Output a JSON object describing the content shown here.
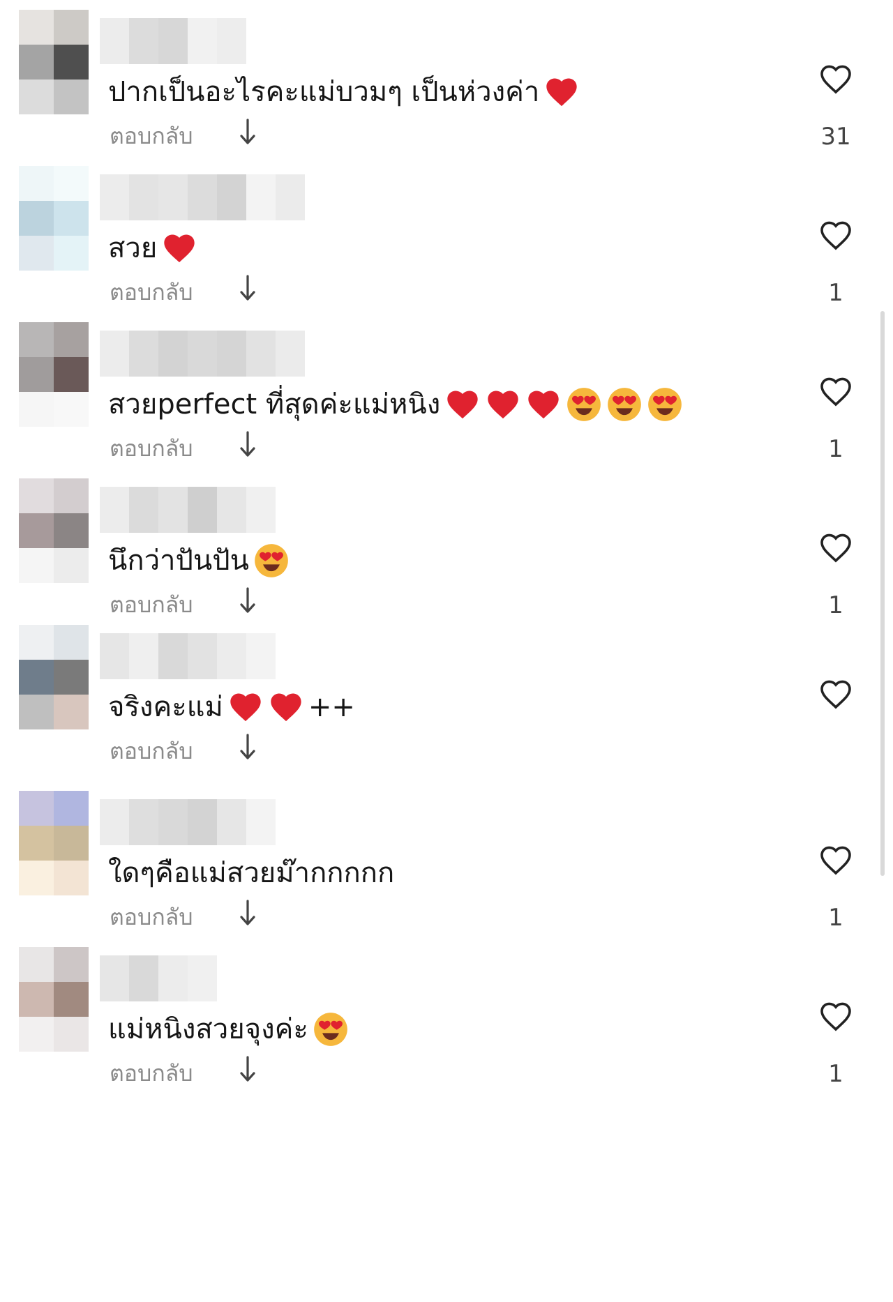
{
  "comments": [
    {
      "text": "ปากเป็นอะไรคะแม่บวมๆ เป็นห่วงค่า",
      "emojis": [
        "heart"
      ],
      "suffix": "",
      "reply_label": "ตอบกลับ",
      "like_count": "31",
      "avatar": [
        "#e6e3e0",
        "#cdcac6",
        "#a4a4a4",
        "#4f4f4f",
        "#dcdcdc",
        "#c3c3c3"
      ],
      "uname": [
        "#ececec",
        "#dcdcdc",
        "#d7d7d7",
        "#f1f1f1",
        "#ededed"
      ]
    },
    {
      "text": "สวย",
      "emojis": [
        "heart"
      ],
      "suffix": "",
      "reply_label": "ตอบกลับ",
      "like_count": "1",
      "avatar": [
        "#eef6f8",
        "#f3fafb",
        "#bcd3de",
        "#cde3ec",
        "#e0e8ee",
        "#e4f3f7"
      ],
      "uname": [
        "#ececec",
        "#e3e3e3",
        "#e6e6e6",
        "#dcdcdc",
        "#d3d3d3",
        "#f3f3f3",
        "#ebebeb"
      ]
    },
    {
      "text": "สวยperfect ที่สุดค่ะแม่หนิง",
      "emojis": [
        "heart",
        "heart",
        "heart",
        "heartEyes",
        "heartEyes",
        "heartEyes"
      ],
      "suffix": "",
      "reply_label": "ตอบกลับ",
      "like_count": "1",
      "avatar": [
        "#b8b6b6",
        "#a7a1a0",
        "#a09c9c",
        "#6a5958",
        "#f6f6f6",
        "#f8f8f8"
      ],
      "uname": [
        "#ececec",
        "#dcdcdc",
        "#d3d3d3",
        "#d9d9d9",
        "#d5d5d5",
        "#e2e2e2",
        "#ebebeb"
      ]
    },
    {
      "text": "นึกว่าปันปัน",
      "emojis": [
        "heartEyes"
      ],
      "suffix": "",
      "reply_label": "ตอบกลับ",
      "like_count": "1",
      "avatar": [
        "#e1dcde",
        "#d3cdcf",
        "#a79a9b",
        "#8b8585",
        "#f5f5f5",
        "#ececec"
      ],
      "uname": [
        "#ececec",
        "#dbdbdb",
        "#e3e3e3",
        "#cfcfcf",
        "#e6e6e6",
        "#f0f0f0"
      ]
    },
    {
      "text": "จริงคะแม่",
      "emojis": [
        "heart",
        "heart"
      ],
      "suffix": "++",
      "reply_label": "ตอบกลับ",
      "like_count": "",
      "avatar": [
        "#eef0f2",
        "#dfe4e8",
        "#6f7d8b",
        "#7a7a7a",
        "#bfbfbf",
        "#d8c6be"
      ],
      "uname": [
        "#e6e6e6",
        "#efefef",
        "#d9d9d9",
        "#e2e2e2",
        "#ececec",
        "#f3f3f3"
      ]
    },
    {
      "text": "ใดๆคือแม่สวยม๊ากกกกก",
      "emojis": [],
      "suffix": "",
      "reply_label": "ตอบกลับ",
      "like_count": "1",
      "avatar": [
        "#c6c3df",
        "#b0b6e0",
        "#d4c2a0",
        "#c8b899",
        "#faf0e0",
        "#f3e4d4"
      ],
      "uname": [
        "#ececec",
        "#dedede",
        "#d9d9d9",
        "#d3d3d3",
        "#e6e6e6",
        "#f3f3f3"
      ]
    },
    {
      "text": "แม่หนิงสวยจุงค่ะ",
      "emojis": [
        "heartEyes"
      ],
      "suffix": "",
      "reply_label": "ตอบกลับ",
      "like_count": "1",
      "avatar": [
        "#e8e6e6",
        "#cdc6c6",
        "#cdb8b0",
        "#a18a80",
        "#f2f0f0",
        "#eae6e6"
      ],
      "uname": [
        "#e6e6e6",
        "#d9d9d9",
        "#ececec",
        "#f0f0f0"
      ]
    }
  ],
  "colors": {
    "heart": "#e0222f",
    "face": "#f6b73c",
    "text": "#161616",
    "muted": "#8a8a8a"
  },
  "icons": {
    "like": "heart-outline-icon",
    "reply_expand": "arrow-down-icon"
  }
}
